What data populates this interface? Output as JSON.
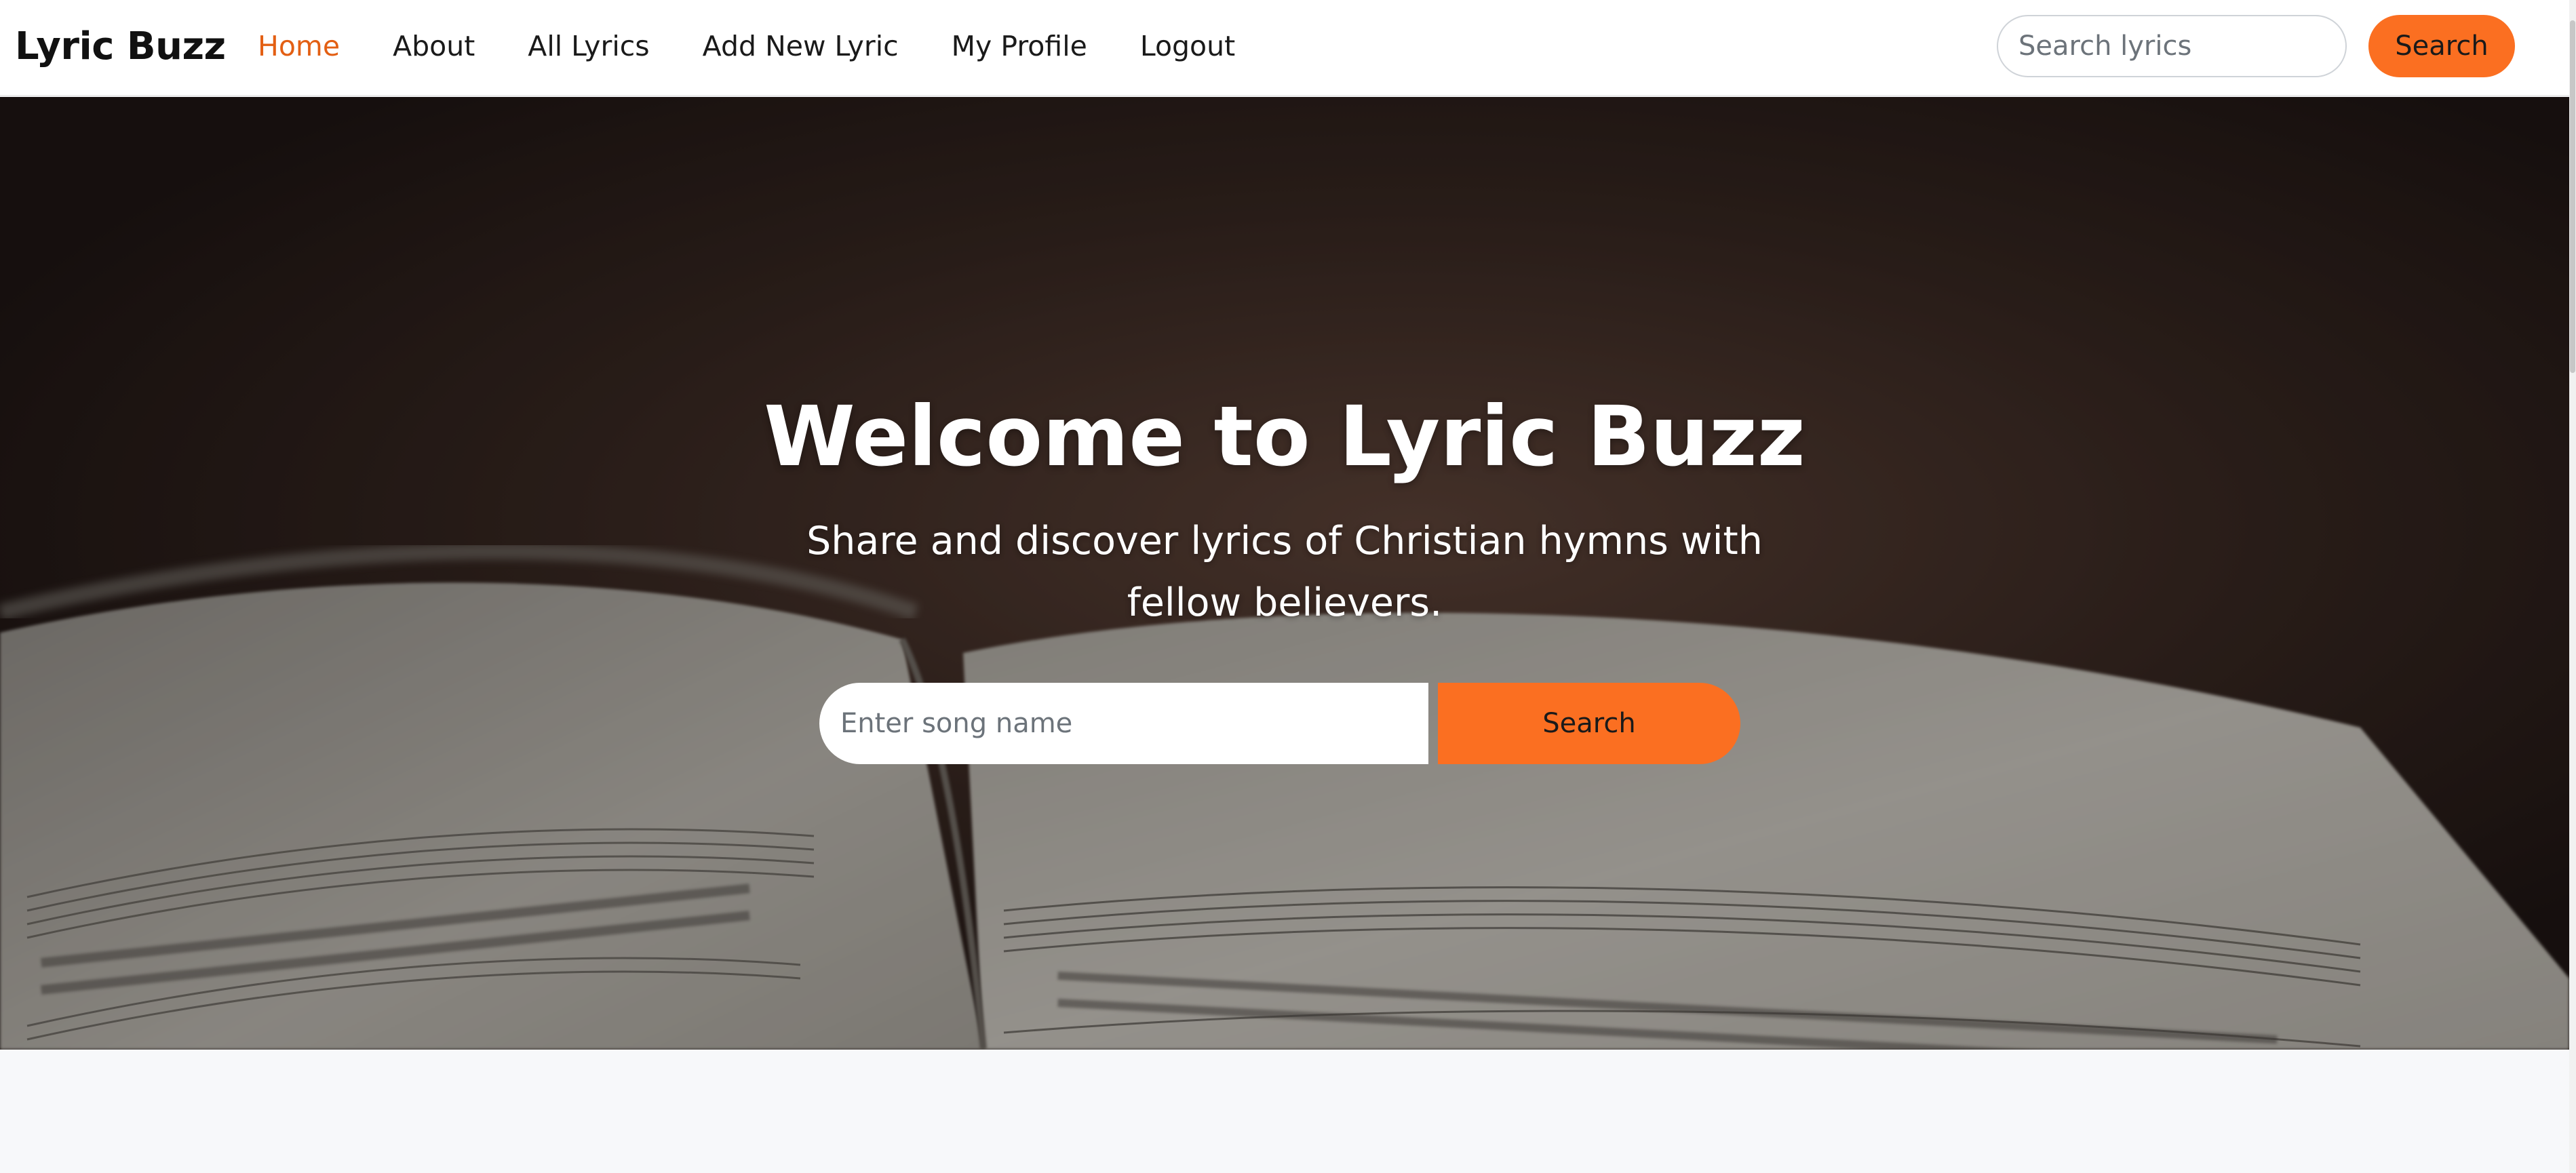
{
  "nav": {
    "brand": "Lyric Buzz",
    "links": [
      {
        "label": "Home",
        "active": true
      },
      {
        "label": "About",
        "active": false
      },
      {
        "label": "All Lyrics",
        "active": false
      },
      {
        "label": "Add New Lyric",
        "active": false
      },
      {
        "label": "My Profile",
        "active": false
      },
      {
        "label": "Logout",
        "active": false
      }
    ],
    "search_placeholder": "Search lyrics",
    "search_button": "Search"
  },
  "hero": {
    "title": "Welcome to Lyric Buzz",
    "subtitle": "Share and discover lyrics of Christian hymns with fellow believers.",
    "input_placeholder": "Enter song name",
    "button_label": "Search"
  },
  "colors": {
    "accent": "#fb6f21",
    "active_link": "#e35f13",
    "navbar_bg": "#ffffff",
    "page_bg": "#f7f8fa"
  }
}
